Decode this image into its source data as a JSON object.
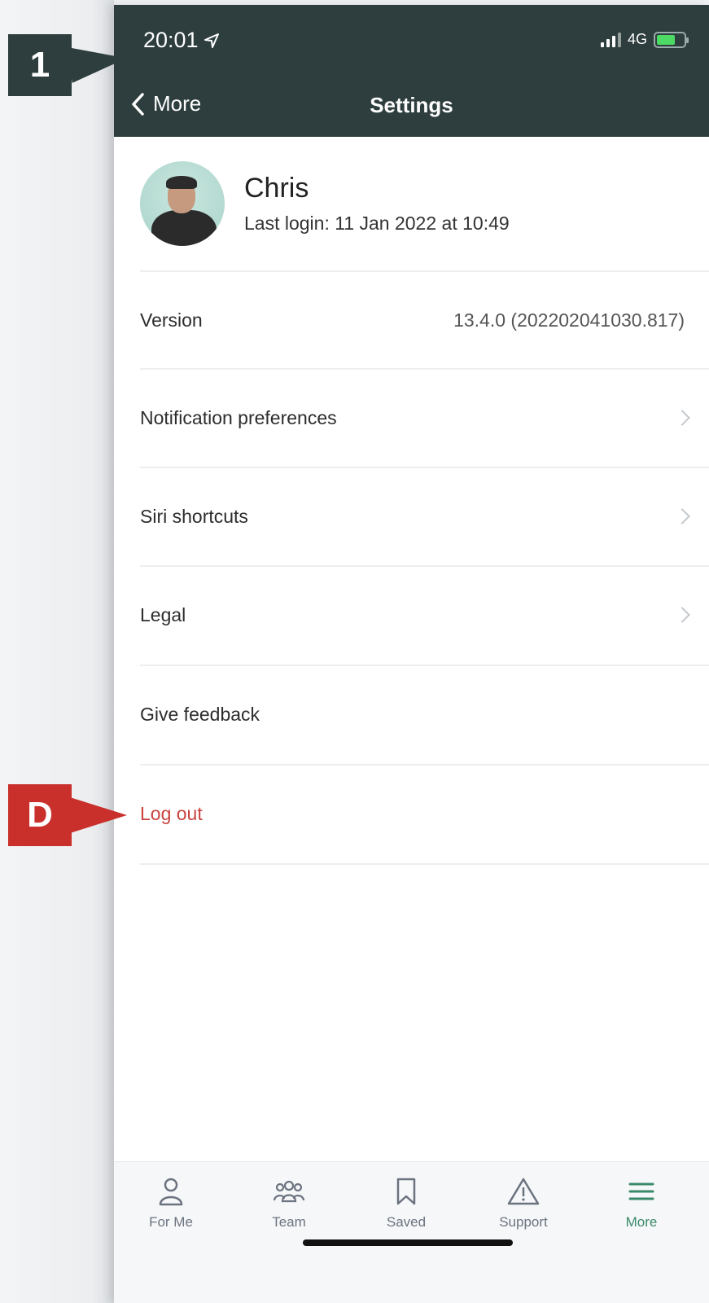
{
  "status_bar": {
    "time": "20:01",
    "network": "4G"
  },
  "nav": {
    "back_label": "More",
    "title": "Settings"
  },
  "profile": {
    "name": "Chris",
    "last_login": "Last login: 11 Jan 2022 at 10:49"
  },
  "settings": {
    "version_label": "Version",
    "version_value": "13.4.0 (202202041030.817)",
    "notification_label": "Notification preferences",
    "siri_label": "Siri shortcuts",
    "legal_label": "Legal",
    "feedback_label": "Give feedback",
    "logout_label": "Log out"
  },
  "tabs": [
    {
      "label": "For Me",
      "icon": "person-icon"
    },
    {
      "label": "Team",
      "icon": "team-icon"
    },
    {
      "label": "Saved",
      "icon": "bookmark-icon"
    },
    {
      "label": "Support",
      "icon": "warning-icon"
    },
    {
      "label": "More",
      "icon": "menu-icon",
      "active": true
    }
  ],
  "callouts": {
    "one": "1",
    "d": "D"
  },
  "colors": {
    "header": "#2e3d3d",
    "logout": "#c9433f",
    "active_tab": "#3a8a6a",
    "callout_red": "#c9302c"
  }
}
